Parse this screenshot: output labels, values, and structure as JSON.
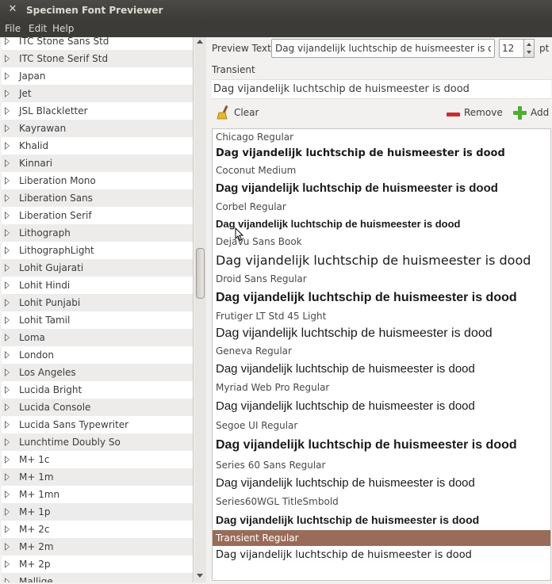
{
  "window": {
    "title": "Specimen Font Previewer"
  },
  "menu": {
    "file": "File",
    "edit": "Edit",
    "help": "Help"
  },
  "font_list": [
    "ITC Stone Sans Std",
    "ITC Stone Serif Std",
    "Japan",
    "Jet",
    "JSL Blackletter",
    "Kayrawan",
    "Khalid",
    "Kinnari",
    "Liberation Mono",
    "Liberation Sans",
    "Liberation Serif",
    "Lithograph",
    "LithographLight",
    "Lohit Gujarati",
    "Lohit Hindi",
    "Lohit Punjabi",
    "Lohit Tamil",
    "Loma",
    "London",
    "Los Angeles",
    "Lucida Bright",
    "Lucida Console",
    "Lucida Sans Typewriter",
    "Lunchtime Doubly So",
    "M+ 1c",
    "M+ 1m",
    "M+ 1mn",
    "M+ 1p",
    "M+ 2c",
    "M+ 2m",
    "M+ 2p",
    "Mallige"
  ],
  "preview_controls": {
    "label": "Preview Text:",
    "text": "Dag vijandelijk luchtschip de huismeester is dood",
    "size": "12",
    "unit": "pt"
  },
  "transient": {
    "label": "Transient",
    "sample": "Dag vijandelijk luchtschip de huismeester is dood"
  },
  "toolbar": {
    "clear": "Clear",
    "remove": "Remove",
    "add": "Add"
  },
  "previews": [
    {
      "name": "Chicago Regular",
      "sample": "Dag vijandelijk luchtschip de huismeester is dood"
    },
    {
      "name": "Coconut Medium",
      "sample": "Dag vijandelijk luchtschip de huismeester is dood"
    },
    {
      "name": "Corbel Regular",
      "sample": "Dag vijandelijk luchtschip de huismeester is dood"
    },
    {
      "name": "DejaVu Sans Book",
      "sample": "Dag vijandelijk luchtschip de huismeester is dood"
    },
    {
      "name": "Droid Sans Regular",
      "sample": "Dag vijandelijk luchtschip de huismeester is dood"
    },
    {
      "name": "Frutiger LT Std 45 Light",
      "sample": "Dag vijandelijk luchtschip de huismeester is dood"
    },
    {
      "name": "Geneva Regular",
      "sample": "Dag vijandelijk luchtschip de huismeester is dood"
    },
    {
      "name": "Myriad Web Pro Regular",
      "sample": "Dag vijandelijk luchtschip de huismeester is dood"
    },
    {
      "name": "Segoe UI Regular",
      "sample": "Dag vijandelijk luchtschip de huismeester is dood"
    },
    {
      "name": "Series 60 Sans Regular",
      "sample": "Dag vijandelijk luchtschip de huismeester is dood"
    },
    {
      "name": "Series60WGL TitleSmbold",
      "sample": "Dag vijandelijk luchtschip de huismeester is dood"
    },
    {
      "name": "Transient Regular",
      "sample": "Dag vijandelijk luchtschip de huismeester is dood",
      "selected": true
    }
  ],
  "colors": {
    "titlebar": "#3c3b37",
    "selection": "#9a6b58",
    "remove_icon": "#d12a2a",
    "add_icon": "#4eae2e"
  }
}
